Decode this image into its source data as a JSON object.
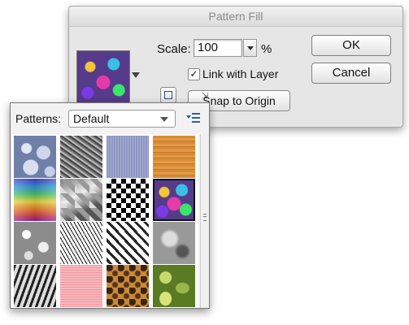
{
  "dialog": {
    "title": "Pattern Fill",
    "scale_label": "Scale:",
    "scale_value": "100",
    "scale_unit": "%",
    "link_with_layer_label": "Link with Layer",
    "link_with_layer_checked": true,
    "snap_to_origin_label": "Snap to Origin",
    "ok_label": "OK",
    "cancel_label": "Cancel",
    "selected_pattern_icon": "psychedelic-pattern-swatch"
  },
  "picker": {
    "label": "Patterns:",
    "selected_set": "Default",
    "menu_icon": "panel-menu-icon",
    "patterns": [
      {
        "name": "bubbles",
        "selected": false
      },
      {
        "name": "gravel",
        "selected": false
      },
      {
        "name": "blue-denim",
        "selected": false
      },
      {
        "name": "wood",
        "selected": false
      },
      {
        "name": "rainbow",
        "selected": false
      },
      {
        "name": "crumpled-paper",
        "selected": false
      },
      {
        "name": "checkerboard",
        "selected": false
      },
      {
        "name": "psychedelic",
        "selected": true
      },
      {
        "name": "blobs",
        "selected": false
      },
      {
        "name": "scribbles",
        "selected": false
      },
      {
        "name": "herringbone",
        "selected": false
      },
      {
        "name": "gray-marble",
        "selected": false
      },
      {
        "name": "zebra",
        "selected": false
      },
      {
        "name": "pink-fabric",
        "selected": false
      },
      {
        "name": "leopard",
        "selected": false
      },
      {
        "name": "leaves",
        "selected": false
      }
    ]
  },
  "colors": {
    "dialog_bg": "#e6e6e6",
    "accent": "#2a5fb0"
  }
}
